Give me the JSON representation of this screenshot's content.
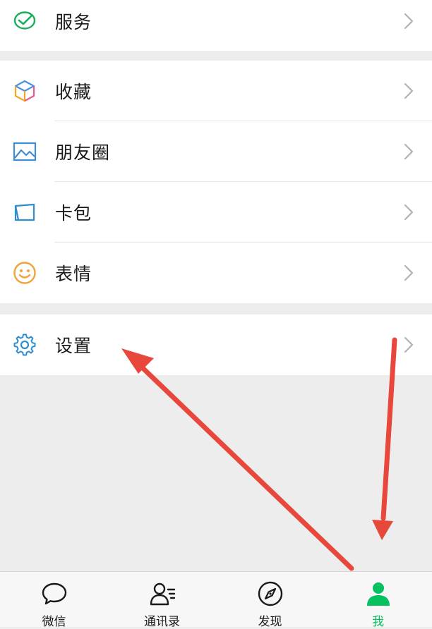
{
  "menu": {
    "service_label": "服务",
    "favorites_label": "收藏",
    "moments_label": "朋友圈",
    "cards_label": "卡包",
    "stickers_label": "表情",
    "settings_label": "设置"
  },
  "tabbar": {
    "chats": "微信",
    "contacts": "通讯录",
    "discover": "发现",
    "me": "我"
  },
  "colors": {
    "accent": "#07c160",
    "annotation_arrow": "#e8473b",
    "background": "#ededed"
  },
  "icons": {
    "service": "service-check-icon",
    "favorites": "cube-icon",
    "moments": "picture-icon",
    "cards": "card-wallet-icon",
    "stickers": "smiley-icon",
    "settings": "gear-icon",
    "chevron": "chevron-right-icon"
  }
}
